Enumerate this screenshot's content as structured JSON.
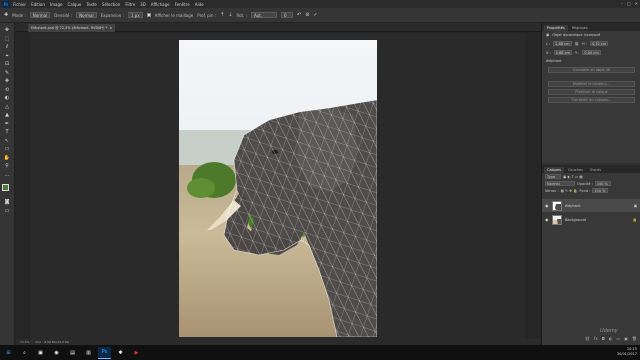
{
  "app": {
    "logo": "Ps",
    "menu": [
      "Fichier",
      "Edition",
      "Image",
      "Calque",
      "Texte",
      "Sélection",
      "Filtre",
      "3D",
      "Affichage",
      "Fenêtre",
      "Aide"
    ],
    "window_controls": [
      "–",
      "□",
      "✕"
    ]
  },
  "options_bar": {
    "mode_label": "Mode :",
    "mode_value": "Normal",
    "opacity_label": "Densité :",
    "opacity_value": "Normal",
    "expansion_label": "Expansion :",
    "expansion_value": "1 px",
    "show_mesh_label": "Afficher le maillage",
    "pin_depth_label": "Prof. pin :",
    "rotation_label": "Rot. :",
    "rotation_value": "Aut.",
    "rotation_degrees": "0",
    "icons": [
      "pin-tool-icon",
      "undo-icon",
      "cancel-icon",
      "commit-icon"
    ]
  },
  "tools": [
    "✥",
    "⬚",
    "ℓ",
    "⌖",
    "⊡",
    "✎",
    "✚",
    "⟲",
    "◐",
    "△",
    "▲",
    "✒",
    "T",
    "↖",
    "▭",
    "✋",
    "⚲",
    "…"
  ],
  "colors": {
    "foreground": "#4c7c35",
    "background": "#ffffff",
    "accent": "#30a8ff"
  },
  "document": {
    "tab_title": "Eléphant.psd @ 72,5% (éléphant, RVB/8*) *",
    "close_glyph": "×",
    "status_zoom": "72,5%",
    "status_doc": "Doc : 6,59 Mo/13,2 Mo"
  },
  "properties_panel": {
    "tabs": [
      "Propriétés",
      "Réglages"
    ],
    "section_title": "Objet dynamique incorporé",
    "w_label": "L :",
    "w_value": "2,88 cm",
    "h_label": "H :",
    "h_value": "4,32 cm",
    "x_label": "X :",
    "x_value": "0,68 cm",
    "y_label": "Y :",
    "y_value": "0,00 cm",
    "file_name": "éléphant",
    "btn_convert": "Convertir en objet lié",
    "btn_edit": "Modifier le contenu...",
    "btn_rasterize": "Pixelliser le calque",
    "btn_layer": "Convertir en calques..."
  },
  "layers_panel": {
    "tabs": [
      "Calques",
      "Couches",
      "Tracés"
    ],
    "filter_label": "Type",
    "blend_mode": "Normal",
    "opacity_label": "Opacité :",
    "opacity_value": "100 %",
    "lock_label": "Verrou :",
    "fill_label": "Fond :",
    "fill_value": "100 %",
    "layers": [
      {
        "name": "éléphant",
        "selected": true
      },
      {
        "name": "Background",
        "selected": false
      }
    ],
    "footer_icons": [
      "link-icon",
      "fx-icon",
      "mask-icon",
      "adjustment-icon",
      "folder-icon",
      "new-layer-icon",
      "trash-icon"
    ]
  },
  "taskbar": {
    "items": [
      "⊞",
      "⌕",
      "▣",
      "◉",
      "▤",
      "▥",
      "Ps",
      "✱",
      "▶"
    ],
    "time": "10:15",
    "date": "30/01/2017"
  },
  "watermark": "Udemy"
}
